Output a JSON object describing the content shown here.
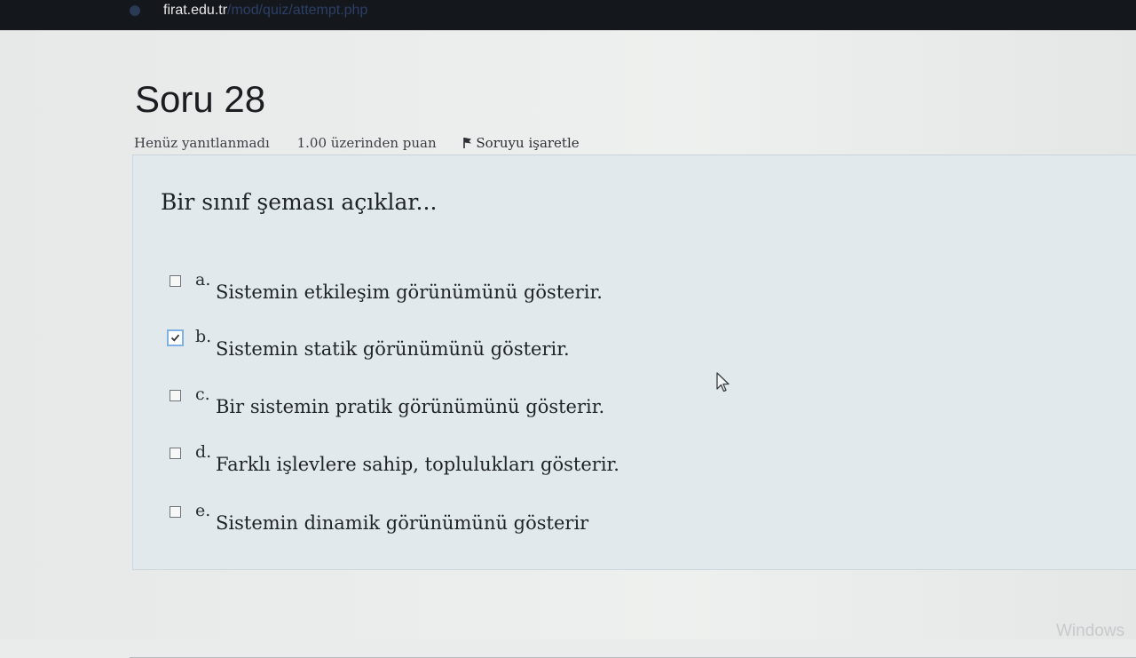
{
  "browser": {
    "url_domain": "firat.edu.tr",
    "url_path": "/mod/quiz/attempt.php"
  },
  "question": {
    "title": "Soru 28",
    "status": "Henüz yanıtlanmadı",
    "points": "1.00 üzerinden puan",
    "flag_label": "Soruyu işaretle",
    "text": "Bir sınıf şeması açıklar...",
    "options": [
      {
        "letter": "a.",
        "text": "Sistemin etkileşim görünümünü gösterir.",
        "checked": false
      },
      {
        "letter": "b.",
        "text": "Sistemin statik görünümünü gösterir.",
        "checked": true
      },
      {
        "letter": "c.",
        "text": "Bir sistemin pratik görünümünü gösterir.",
        "checked": false
      },
      {
        "letter": "d.",
        "text": "Farklı işlevlere sahip, toplulukları gösterir.",
        "checked": false
      },
      {
        "letter": "e.",
        "text": "Sistemin dinamik görünümünü gösterir",
        "checked": false
      }
    ]
  },
  "watermark": "Windows",
  "icons": {
    "flag": "flag-icon",
    "checkmark": "checkmark-icon",
    "cursor": "mouse-cursor-icon"
  }
}
